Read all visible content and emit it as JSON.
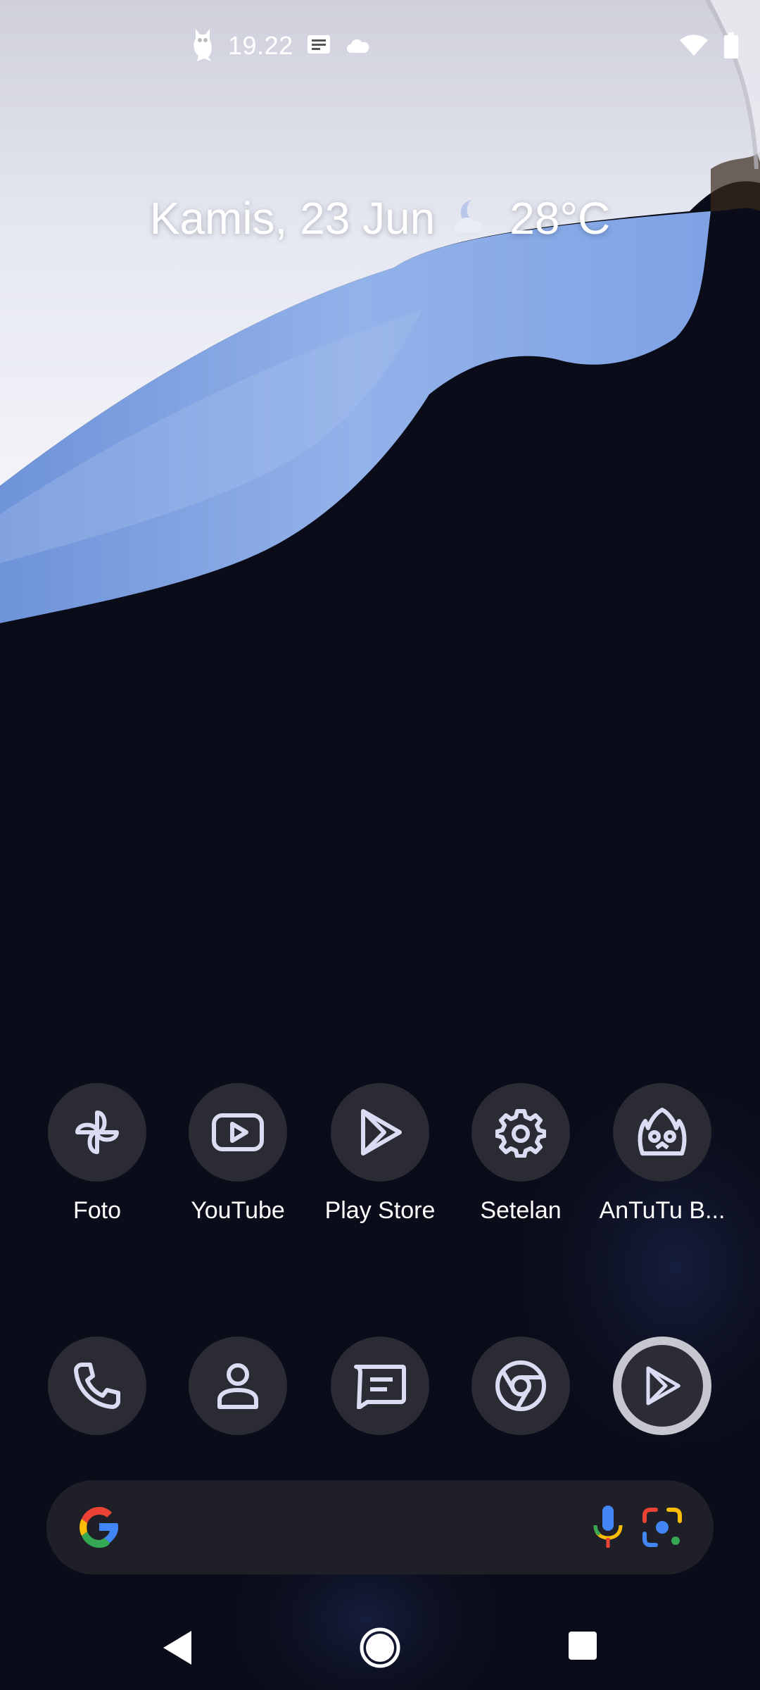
{
  "status_bar": {
    "time": "19.22",
    "left_icons": [
      "owl-app-icon",
      "message-notification-icon",
      "cloud-icon"
    ],
    "right_icons": [
      "wifi-icon",
      "battery-icon"
    ]
  },
  "glance": {
    "date": "Kamis, 23 Jun",
    "weather_icon": "moon-cloud-icon",
    "temperature": "28°C"
  },
  "apps_row": [
    {
      "label": "Foto",
      "icon": "pinwheel-icon"
    },
    {
      "label": "YouTube",
      "icon": "youtube-icon"
    },
    {
      "label": "Play Store",
      "icon": "play-store-icon"
    },
    {
      "label": "Setelan",
      "icon": "gear-icon"
    },
    {
      "label": "AnTuTu B...",
      "icon": "antutu-icon"
    }
  ],
  "dock": [
    {
      "icon": "phone-icon"
    },
    {
      "icon": "contacts-icon"
    },
    {
      "icon": "messages-icon"
    },
    {
      "icon": "chrome-icon"
    },
    {
      "icon": "play-store-icon"
    }
  ],
  "search_bar": {
    "icons": [
      "google-g-icon",
      "microphone-icon",
      "lens-icon"
    ]
  },
  "nav_bar": {
    "icons": [
      "back-icon",
      "home-icon",
      "recents-icon"
    ]
  },
  "colors": {
    "wallpaper_dark": "#0b0c19",
    "wallpaper_blue": "#87a9e6",
    "wallpaper_light": "#e4e6f0",
    "icon_bg": "#2a2b33",
    "icon_stroke": "#d9dcf2"
  }
}
